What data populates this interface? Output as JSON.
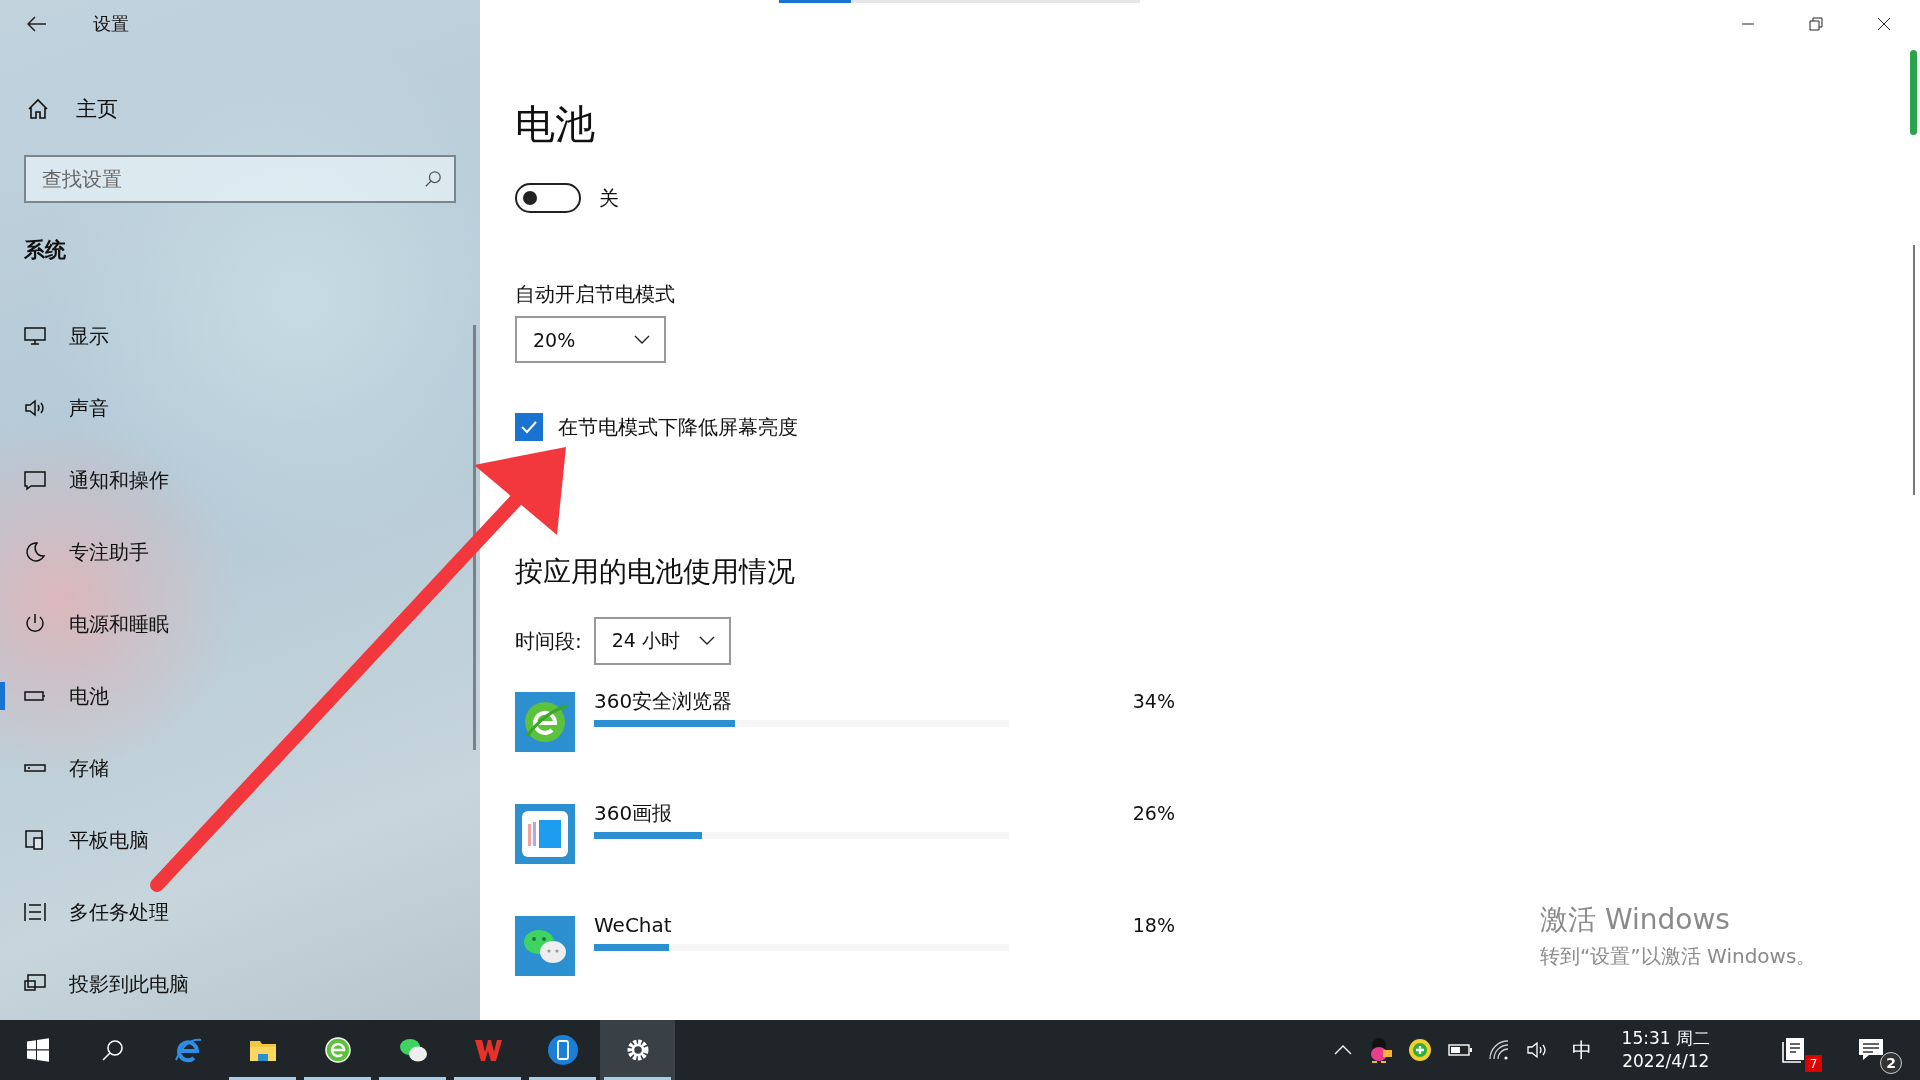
{
  "window": {
    "title": "设置"
  },
  "sidebar": {
    "home": "主页",
    "search": {
      "placeholder": "查找设置"
    },
    "section": "系统",
    "items": [
      {
        "label": "显示",
        "selected": false
      },
      {
        "label": "声音",
        "selected": false
      },
      {
        "label": "通知和操作",
        "selected": false
      },
      {
        "label": "专注助手",
        "selected": false
      },
      {
        "label": "电源和睡眠",
        "selected": false
      },
      {
        "label": "电池",
        "selected": true
      },
      {
        "label": "存储",
        "selected": false
      },
      {
        "label": "平板电脑",
        "selected": false
      },
      {
        "label": "多任务处理",
        "selected": false
      },
      {
        "label": "投影到此电脑",
        "selected": false
      }
    ]
  },
  "loading": {
    "level": 0.2
  },
  "page": {
    "title": "电池",
    "toggle": {
      "on": false,
      "label": "关"
    },
    "saver": {
      "label": "自动开启节电模式",
      "value": "20%"
    },
    "dim": {
      "checked": true,
      "label": "在节电模式下降低屏幕亮度"
    },
    "usage": {
      "heading": "按应用的电池使用情况",
      "period_label": "时间段:",
      "period": "24 小时",
      "apps": [
        {
          "name": "360安全浏览器",
          "percent": "34%",
          "level": 0.34
        },
        {
          "name": "360画报",
          "percent": "26%",
          "level": 0.26
        },
        {
          "name": "WeChat",
          "percent": "18%",
          "level": 0.18
        }
      ]
    }
  },
  "activation": {
    "title": "激活 Windows",
    "hint": "转到“设置”以激活 Windows。"
  },
  "taskbar": {
    "apps": [
      {
        "running": false,
        "selected": false
      },
      {
        "running": true,
        "selected": false
      },
      {
        "running": true,
        "selected": false
      },
      {
        "running": true,
        "selected": false
      },
      {
        "running": true,
        "selected": false
      },
      {
        "running": true,
        "selected": false
      },
      {
        "running": true,
        "selected": true
      }
    ],
    "ime": "中",
    "time": "15:31 周二",
    "date": "2022/4/12",
    "notes_badge": "7",
    "action_badge": "2"
  }
}
